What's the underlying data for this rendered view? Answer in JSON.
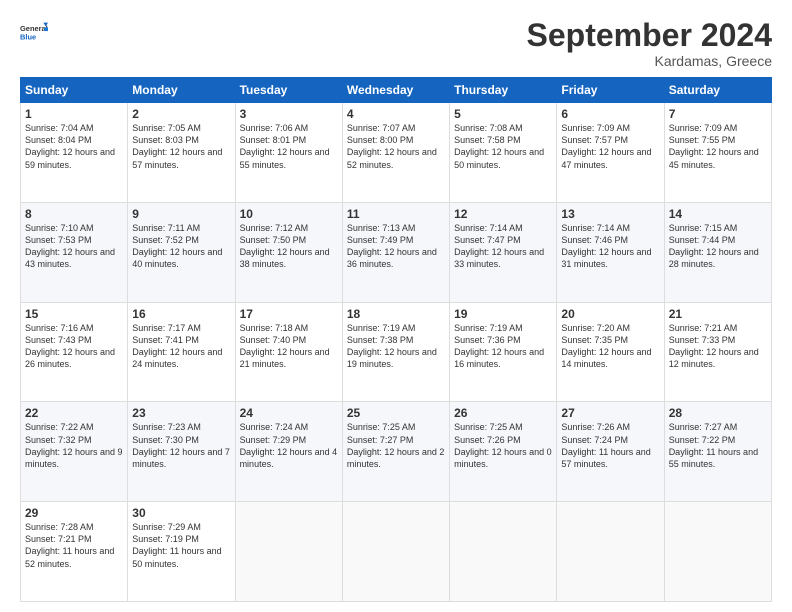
{
  "logo": {
    "line1": "General",
    "line2": "Blue"
  },
  "title": "September 2024",
  "subtitle": "Kardamas, Greece",
  "days_header": [
    "Sunday",
    "Monday",
    "Tuesday",
    "Wednesday",
    "Thursday",
    "Friday",
    "Saturday"
  ],
  "weeks": [
    [
      {
        "day": "1",
        "info": "Sunrise: 7:04 AM\nSunset: 8:04 PM\nDaylight: 12 hours\nand 59 minutes."
      },
      {
        "day": "2",
        "info": "Sunrise: 7:05 AM\nSunset: 8:03 PM\nDaylight: 12 hours\nand 57 minutes."
      },
      {
        "day": "3",
        "info": "Sunrise: 7:06 AM\nSunset: 8:01 PM\nDaylight: 12 hours\nand 55 minutes."
      },
      {
        "day": "4",
        "info": "Sunrise: 7:07 AM\nSunset: 8:00 PM\nDaylight: 12 hours\nand 52 minutes."
      },
      {
        "day": "5",
        "info": "Sunrise: 7:08 AM\nSunset: 7:58 PM\nDaylight: 12 hours\nand 50 minutes."
      },
      {
        "day": "6",
        "info": "Sunrise: 7:09 AM\nSunset: 7:57 PM\nDaylight: 12 hours\nand 47 minutes."
      },
      {
        "day": "7",
        "info": "Sunrise: 7:09 AM\nSunset: 7:55 PM\nDaylight: 12 hours\nand 45 minutes."
      }
    ],
    [
      {
        "day": "8",
        "info": "Sunrise: 7:10 AM\nSunset: 7:53 PM\nDaylight: 12 hours\nand 43 minutes."
      },
      {
        "day": "9",
        "info": "Sunrise: 7:11 AM\nSunset: 7:52 PM\nDaylight: 12 hours\nand 40 minutes."
      },
      {
        "day": "10",
        "info": "Sunrise: 7:12 AM\nSunset: 7:50 PM\nDaylight: 12 hours\nand 38 minutes."
      },
      {
        "day": "11",
        "info": "Sunrise: 7:13 AM\nSunset: 7:49 PM\nDaylight: 12 hours\nand 36 minutes."
      },
      {
        "day": "12",
        "info": "Sunrise: 7:14 AM\nSunset: 7:47 PM\nDaylight: 12 hours\nand 33 minutes."
      },
      {
        "day": "13",
        "info": "Sunrise: 7:14 AM\nSunset: 7:46 PM\nDaylight: 12 hours\nand 31 minutes."
      },
      {
        "day": "14",
        "info": "Sunrise: 7:15 AM\nSunset: 7:44 PM\nDaylight: 12 hours\nand 28 minutes."
      }
    ],
    [
      {
        "day": "15",
        "info": "Sunrise: 7:16 AM\nSunset: 7:43 PM\nDaylight: 12 hours\nand 26 minutes."
      },
      {
        "day": "16",
        "info": "Sunrise: 7:17 AM\nSunset: 7:41 PM\nDaylight: 12 hours\nand 24 minutes."
      },
      {
        "day": "17",
        "info": "Sunrise: 7:18 AM\nSunset: 7:40 PM\nDaylight: 12 hours\nand 21 minutes."
      },
      {
        "day": "18",
        "info": "Sunrise: 7:19 AM\nSunset: 7:38 PM\nDaylight: 12 hours\nand 19 minutes."
      },
      {
        "day": "19",
        "info": "Sunrise: 7:19 AM\nSunset: 7:36 PM\nDaylight: 12 hours\nand 16 minutes."
      },
      {
        "day": "20",
        "info": "Sunrise: 7:20 AM\nSunset: 7:35 PM\nDaylight: 12 hours\nand 14 minutes."
      },
      {
        "day": "21",
        "info": "Sunrise: 7:21 AM\nSunset: 7:33 PM\nDaylight: 12 hours\nand 12 minutes."
      }
    ],
    [
      {
        "day": "22",
        "info": "Sunrise: 7:22 AM\nSunset: 7:32 PM\nDaylight: 12 hours\nand 9 minutes."
      },
      {
        "day": "23",
        "info": "Sunrise: 7:23 AM\nSunset: 7:30 PM\nDaylight: 12 hours\nand 7 minutes."
      },
      {
        "day": "24",
        "info": "Sunrise: 7:24 AM\nSunset: 7:29 PM\nDaylight: 12 hours\nand 4 minutes."
      },
      {
        "day": "25",
        "info": "Sunrise: 7:25 AM\nSunset: 7:27 PM\nDaylight: 12 hours\nand 2 minutes."
      },
      {
        "day": "26",
        "info": "Sunrise: 7:25 AM\nSunset: 7:26 PM\nDaylight: 12 hours\nand 0 minutes."
      },
      {
        "day": "27",
        "info": "Sunrise: 7:26 AM\nSunset: 7:24 PM\nDaylight: 11 hours\nand 57 minutes."
      },
      {
        "day": "28",
        "info": "Sunrise: 7:27 AM\nSunset: 7:22 PM\nDaylight: 11 hours\nand 55 minutes."
      }
    ],
    [
      {
        "day": "29",
        "info": "Sunrise: 7:28 AM\nSunset: 7:21 PM\nDaylight: 11 hours\nand 52 minutes."
      },
      {
        "day": "30",
        "info": "Sunrise: 7:29 AM\nSunset: 7:19 PM\nDaylight: 11 hours\nand 50 minutes."
      },
      {
        "day": "",
        "info": ""
      },
      {
        "day": "",
        "info": ""
      },
      {
        "day": "",
        "info": ""
      },
      {
        "day": "",
        "info": ""
      },
      {
        "day": "",
        "info": ""
      }
    ]
  ]
}
